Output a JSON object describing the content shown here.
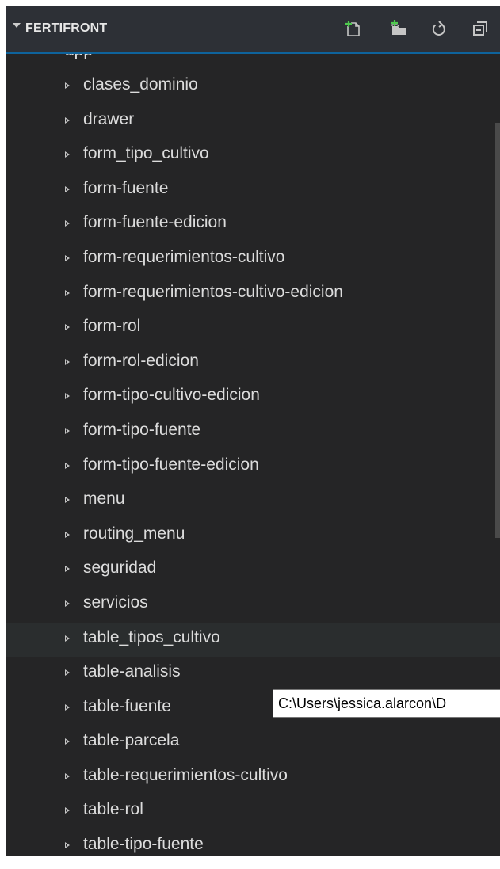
{
  "explorer": {
    "section_title": "FERTIFRONT",
    "header_icons": [
      "new-file-icon",
      "new-folder-icon",
      "refresh-icon",
      "collapse-all-icon"
    ],
    "root_folder": "app",
    "items": [
      {
        "label": "clases_dominio"
      },
      {
        "label": "drawer"
      },
      {
        "label": "form_tipo_cultivo"
      },
      {
        "label": "form-fuente"
      },
      {
        "label": "form-fuente-edicion"
      },
      {
        "label": "form-requerimientos-cultivo"
      },
      {
        "label": "form-requerimientos-cultivo-edicion"
      },
      {
        "label": "form-rol"
      },
      {
        "label": "form-rol-edicion"
      },
      {
        "label": "form-tipo-cultivo-edicion"
      },
      {
        "label": "form-tipo-fuente"
      },
      {
        "label": "form-tipo-fuente-edicion"
      },
      {
        "label": "menu"
      },
      {
        "label": "routing_menu"
      },
      {
        "label": "seguridad"
      },
      {
        "label": "servicios"
      },
      {
        "label": "table_tipos_cultivo"
      },
      {
        "label": "table-analisis"
      },
      {
        "label": "table-fuente"
      },
      {
        "label": "table-parcela"
      },
      {
        "label": "table-requerimientos-cultivo"
      },
      {
        "label": "table-rol"
      },
      {
        "label": "table-tipo-fuente"
      }
    ],
    "hovered_item": "table_tipos_cultivo"
  },
  "tooltip": {
    "text": "C:\\Users\\jessica.alarcon\\D"
  },
  "colors": {
    "sidebar_bg": "#252526",
    "header_bg": "#2d3036",
    "hover_bg": "#2a2d2e",
    "text": "#dcdcdc",
    "accent_green": "#4ec94e"
  }
}
